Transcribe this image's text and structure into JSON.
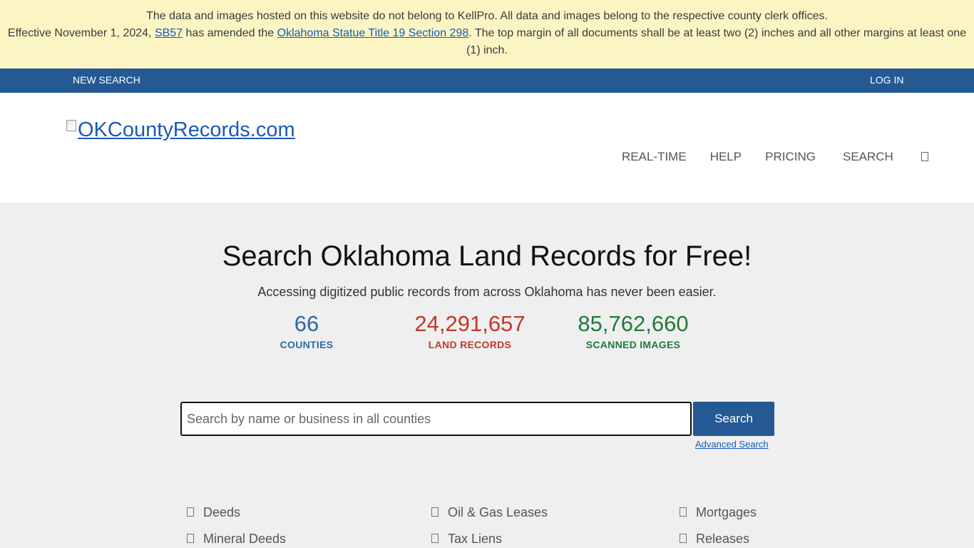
{
  "notice": {
    "line1": "The data and images hosted on this website do not belong to KellPro. All data and images belong to the respective county clerk offices.",
    "line2_prefix": "Effective November 1, 2024, ",
    "line2_link1": "SB57",
    "line2_mid": " has amended the ",
    "line2_link2": "Oklahoma Statue Title 19 Section 298",
    "line2_suffix": ". The top margin of all documents shall be at least two (2) inches and all other margins at least one (1) inch."
  },
  "topbar": {
    "new_search": "NEW SEARCH",
    "login": "LOG IN"
  },
  "header": {
    "logo_alt": "OKCountyRecords.com",
    "nav": {
      "realtime": "REAL-TIME",
      "help": "HELP",
      "pricing": "PRICING",
      "search": "SEARCH"
    }
  },
  "hero": {
    "title": "Search Oklahoma Land Records for Free!",
    "subtitle": "Accessing digitized public records from across Oklahoma has never been easier."
  },
  "stats": [
    {
      "value": "66",
      "label": "COUNTIES"
    },
    {
      "value": "24,291,657",
      "label": "LAND RECORDS"
    },
    {
      "value": "85,762,660",
      "label": "SCANNED IMAGES"
    }
  ],
  "search": {
    "placeholder": "Search by name or business in all counties",
    "button": "Search",
    "advanced": "Advanced Search"
  },
  "categories": [
    "Deeds",
    "Oil & Gas Leases",
    "Mortgages",
    "Mineral Deeds",
    "Tax Liens",
    "Releases"
  ],
  "colors": {
    "accent": "#245994",
    "banner": "#fbf5c4",
    "counties": "#2a6aa4",
    "records": "#c0392b",
    "images": "#207a3c"
  }
}
